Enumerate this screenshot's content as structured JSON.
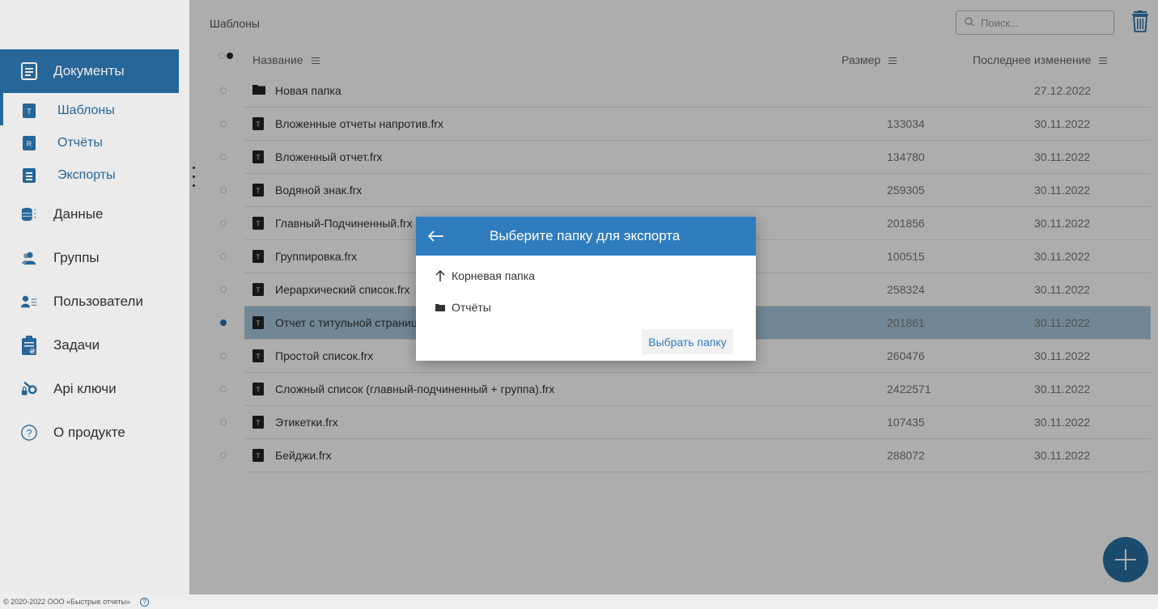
{
  "sidebar": {
    "documents": {
      "label": "Документы",
      "icon": "document-icon"
    },
    "sub_items": [
      {
        "label": "Шаблоны",
        "icon": "template-file-icon",
        "letter": "T"
      },
      {
        "label": "Отчёты",
        "icon": "report-file-icon",
        "letter": "R"
      },
      {
        "label": "Экспорты",
        "icon": "export-file-icon"
      }
    ],
    "items": [
      {
        "label": "Данные",
        "icon": "database-icon"
      },
      {
        "label": "Группы",
        "icon": "groups-icon"
      },
      {
        "label": "Пользователи",
        "icon": "users-icon"
      },
      {
        "label": "Задачи",
        "icon": "tasks-icon"
      },
      {
        "label": "Api ключи",
        "icon": "api-keys-icon"
      },
      {
        "label": "О продукте",
        "icon": "help-circle-icon"
      }
    ]
  },
  "header": {
    "breadcrumb": "Шаблоны",
    "search_placeholder": "Поиск..."
  },
  "table": {
    "columns": {
      "name": "Название",
      "size": "Размер",
      "modified": "Последнее изменение"
    },
    "rows": [
      {
        "name": "Новая папка",
        "size": "",
        "date": "27.12.2022",
        "type": "folder",
        "selected": false
      },
      {
        "name": "Вложенные отчеты напротив.frx",
        "size": "133034",
        "date": "30.11.2022",
        "type": "file",
        "selected": false
      },
      {
        "name": "Вложенный отчет.frx",
        "size": "134780",
        "date": "30.11.2022",
        "type": "file",
        "selected": false
      },
      {
        "name": "Водяной знак.frx",
        "size": "259305",
        "date": "30.11.2022",
        "type": "file",
        "selected": false
      },
      {
        "name": "Главный-Подчиненный.frx",
        "size": "201856",
        "date": "30.11.2022",
        "type": "file",
        "selected": false
      },
      {
        "name": "Группировка.frx",
        "size": "100515",
        "date": "30.11.2022",
        "type": "file",
        "selected": false
      },
      {
        "name": "Иерархический список.frx",
        "size": "258324",
        "date": "30.11.2022",
        "type": "file",
        "selected": false
      },
      {
        "name": "Отчет с титульной страницей.frx",
        "size": "201861",
        "date": "30.11.2022",
        "type": "file",
        "selected": true
      },
      {
        "name": "Простой список.frx",
        "size": "260476",
        "date": "30.11.2022",
        "type": "file",
        "selected": false
      },
      {
        "name": "Сложный список (главный-подчиненный + группа).frx",
        "size": "2422571",
        "date": "30.11.2022",
        "type": "file",
        "selected": false
      },
      {
        "name": "Этикетки.frx",
        "size": "107435",
        "date": "30.11.2022",
        "type": "file",
        "selected": false
      },
      {
        "name": "Бейджи.frx",
        "size": "288072",
        "date": "30.11.2022",
        "type": "file",
        "selected": false
      }
    ]
  },
  "dialog": {
    "title": "Выберите папку для экспорта",
    "back_icon": "arrow-left-icon",
    "items": [
      {
        "label": "Корневая папка",
        "icon": "arrow-up-icon"
      },
      {
        "label": "Отчёты",
        "icon": "folder-icon"
      }
    ],
    "confirm_label": "Выбрать папку"
  },
  "footer": {
    "copyright": "© 2020-2022 ООО «Быстрые отчеты»"
  },
  "colors": {
    "accent": "#2a6fa6",
    "dialog_header": "#2f7cbf",
    "selected_row": "#a9c7de"
  }
}
